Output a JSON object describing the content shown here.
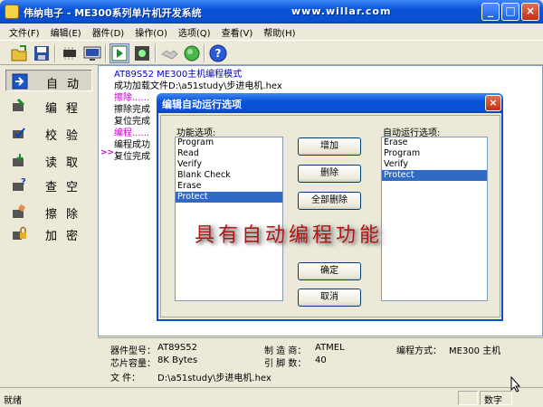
{
  "window": {
    "title": "伟纳电子 - ME300系列单片机开发系统",
    "url": "www.willar.com",
    "minimize_glyph": "_",
    "maximize_glyph": "□",
    "close_glyph": "×"
  },
  "menu": [
    "文件(F)",
    "编辑(E)",
    "器件(D)",
    "操作(O)",
    "选项(Q)",
    "查看(V)",
    "帮助(H)"
  ],
  "toolbar_icons": [
    "open-folder-icon",
    "save-disk-icon",
    "chip-icon",
    "monitor-icon",
    "play-run-icon",
    "chip-settings-icon",
    "handshake-icon",
    "green-circle-icon",
    "help-icon"
  ],
  "sidebar": {
    "items": [
      {
        "label": "自动",
        "icon": "arrow-right-icon"
      },
      {
        "label": "编程",
        "icon": "program-icon"
      },
      {
        "label": "校验",
        "icon": "verify-icon"
      },
      {
        "label": "读取",
        "icon": "read-icon"
      },
      {
        "label": "查空",
        "icon": "blank-check-icon"
      },
      {
        "label": "擦除",
        "icon": "erase-icon"
      },
      {
        "label": "加密",
        "icon": "lock-icon"
      }
    ]
  },
  "log": {
    "lines": [
      {
        "text": "AT89S52   ME300主机编程模式",
        "style": "blue"
      },
      {
        "text": "成功加载文件D:\\a51study\\步进电机.hex",
        "style": "normal"
      },
      {
        "text": "擦除......",
        "style": "magenta"
      },
      {
        "text": "擦除完成",
        "style": "normal"
      },
      {
        "text": "复位完成",
        "style": "normal"
      },
      {
        "text": "编程......",
        "style": "magenta"
      },
      {
        "text": "编程成功",
        "style": "normal"
      },
      {
        "text": "复位完成",
        "style": "normal"
      }
    ],
    "arrow": ">>"
  },
  "dialog": {
    "title": "编辑自动运行选项",
    "close_glyph": "×",
    "func_label": "功能选项:",
    "func_options": [
      "Program",
      "Read",
      "Verify",
      "Blank Check",
      "Erase",
      "Protect"
    ],
    "func_selected": "Protect",
    "auto_label": "自动运行选项:",
    "auto_options": [
      "Erase",
      "Program",
      "Verify",
      "Protect"
    ],
    "auto_selected": "Protect",
    "buttons": {
      "add": "增加",
      "delete": "删除",
      "delete_all": "全部删除",
      "ok": "确定",
      "cancel": "取消"
    },
    "watermark": "具有自动编程功能"
  },
  "info": {
    "model_label": "器件型号：",
    "model": "AT89S52",
    "maker_label": "制 造 商：",
    "maker": "ATMEL",
    "mode_label": "编程方式：",
    "mode": "ME300 主机",
    "capacity_label": "芯片容量：",
    "capacity": "8K Bytes",
    "pins_label": "引 脚 数：",
    "pins": "40",
    "file_label": "文    件：",
    "file": "D:\\a51study\\步进电机.hex"
  },
  "status": {
    "ready": "就绪",
    "mode": "数字"
  }
}
